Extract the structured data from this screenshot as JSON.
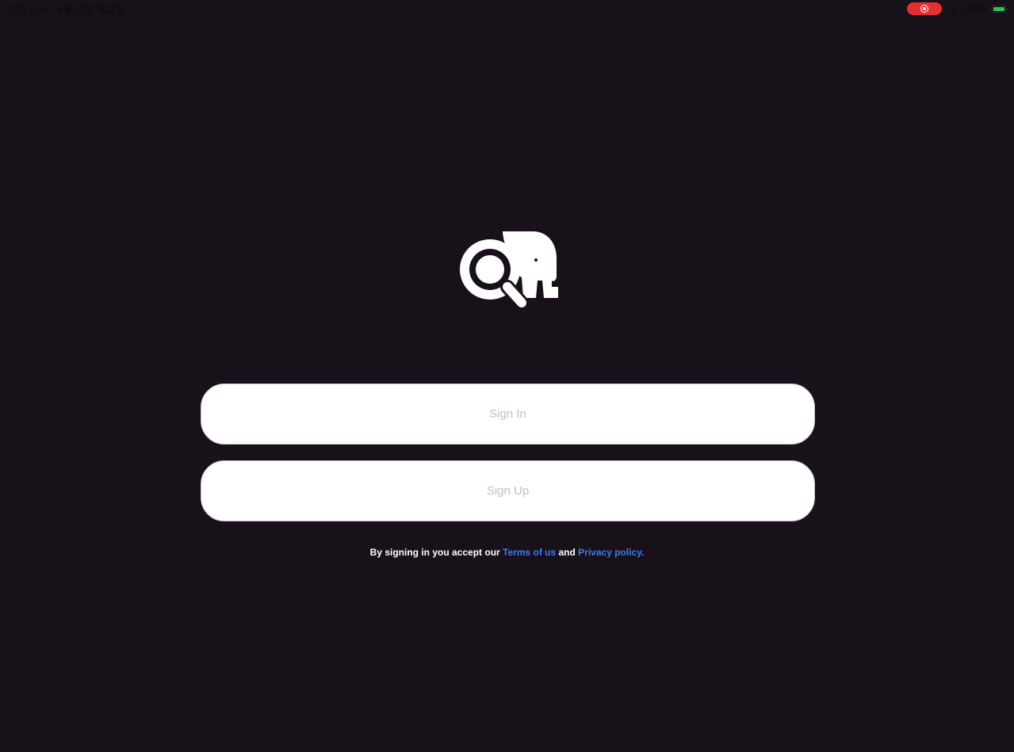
{
  "status_bar": {
    "time": "오전 5:36",
    "date": "8월 17일 화요일",
    "battery_percent": "100%",
    "recording_color": "#e5302f",
    "battery_color": "#2fc04b"
  },
  "logo": {
    "icon": "magnifier-elephant-logo"
  },
  "buttons": {
    "sign_in": "Sign In",
    "sign_up": "Sign Up"
  },
  "legal": {
    "prefix": "By signing in you accept our ",
    "terms_link": "Terms of us",
    "middle": " and ",
    "privacy_link": "Privacy policy."
  },
  "colors": {
    "background": "#18111a",
    "link": "#3b7cf0"
  }
}
